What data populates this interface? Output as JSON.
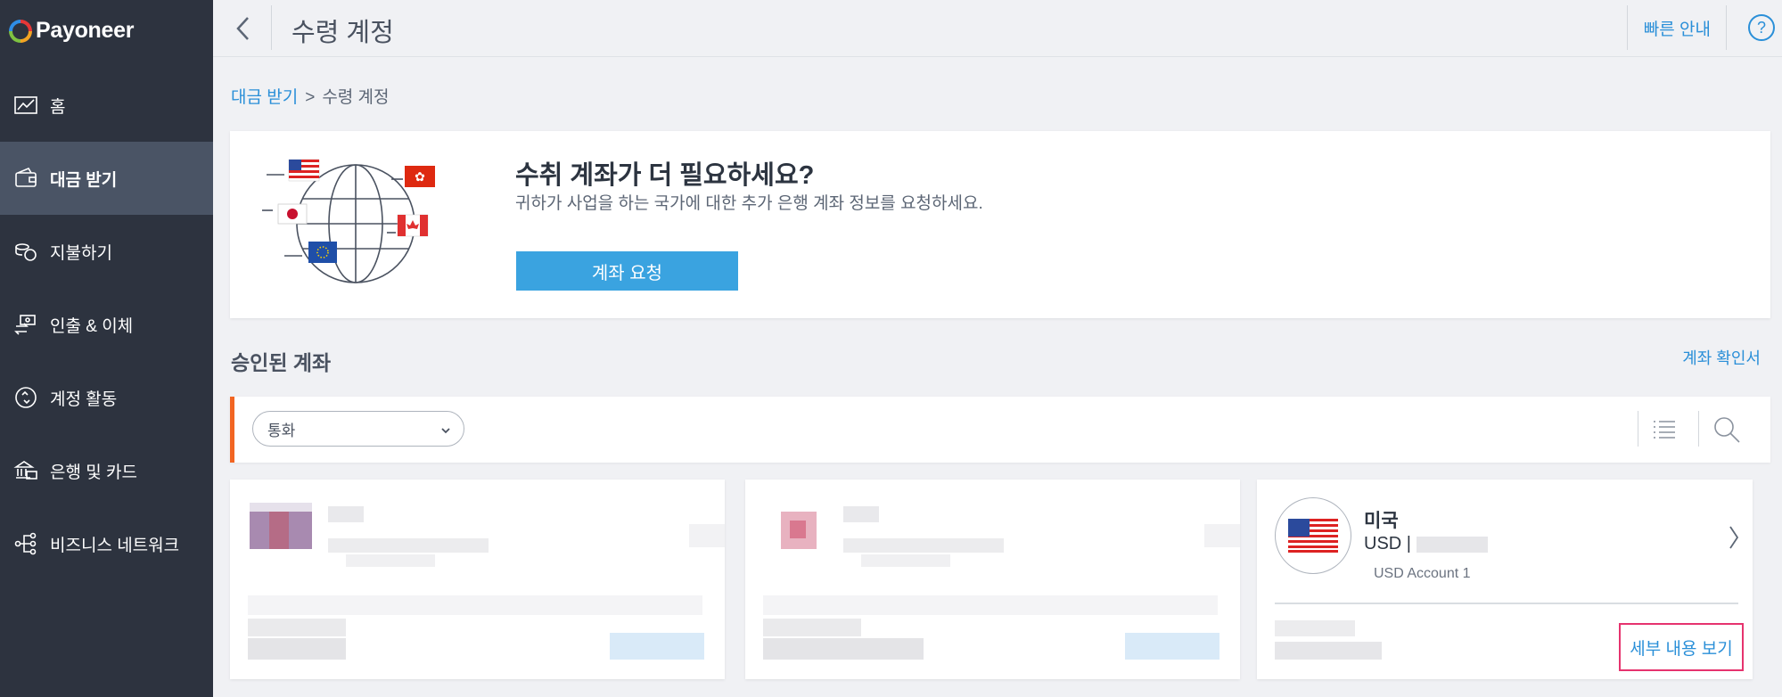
{
  "app": {
    "brand": "Payoneer"
  },
  "sidebar": {
    "items": [
      {
        "label": "홈",
        "icon": "chart-icon"
      },
      {
        "label": "대금 받기",
        "icon": "wallet-icon",
        "active": true
      },
      {
        "label": "지불하기",
        "icon": "coins-icon"
      },
      {
        "label": "인출 & 이체",
        "icon": "transfer-icon"
      },
      {
        "label": "계정 활동",
        "icon": "activity-icon"
      },
      {
        "label": "은행 및 카드",
        "icon": "bank-icon"
      },
      {
        "label": "비즈니스 네트워크",
        "icon": "network-icon"
      }
    ]
  },
  "header": {
    "title": "수령 계정",
    "quick_guide": "빠른 안내",
    "help": "?"
  },
  "breadcrumb": {
    "parent": "대금 받기",
    "separator": ">",
    "current": "수령 계정"
  },
  "promo": {
    "title": "수취 계좌가 더 필요하세요?",
    "description": "귀하가 사업을 하는 국가에 대한 추가 은행 계좌 정보를 요청하세요.",
    "button": "계좌 요청"
  },
  "approved": {
    "title": "승인된 계좌",
    "confirm_link": "계좌 확인서",
    "filter": {
      "selected": "통화"
    }
  },
  "account_card": {
    "country": "미국",
    "currency_line": "USD | ",
    "account_name": "USD Account 1",
    "details_link": "세부 내용 보기"
  },
  "colors": {
    "sidebar_bg": "#2d333f",
    "active_item": "#4a5465",
    "accent_blue": "#2a8fd8",
    "button_blue": "#3aa3e0",
    "filter_accent": "#f26522",
    "highlight_border": "#e6336e"
  }
}
